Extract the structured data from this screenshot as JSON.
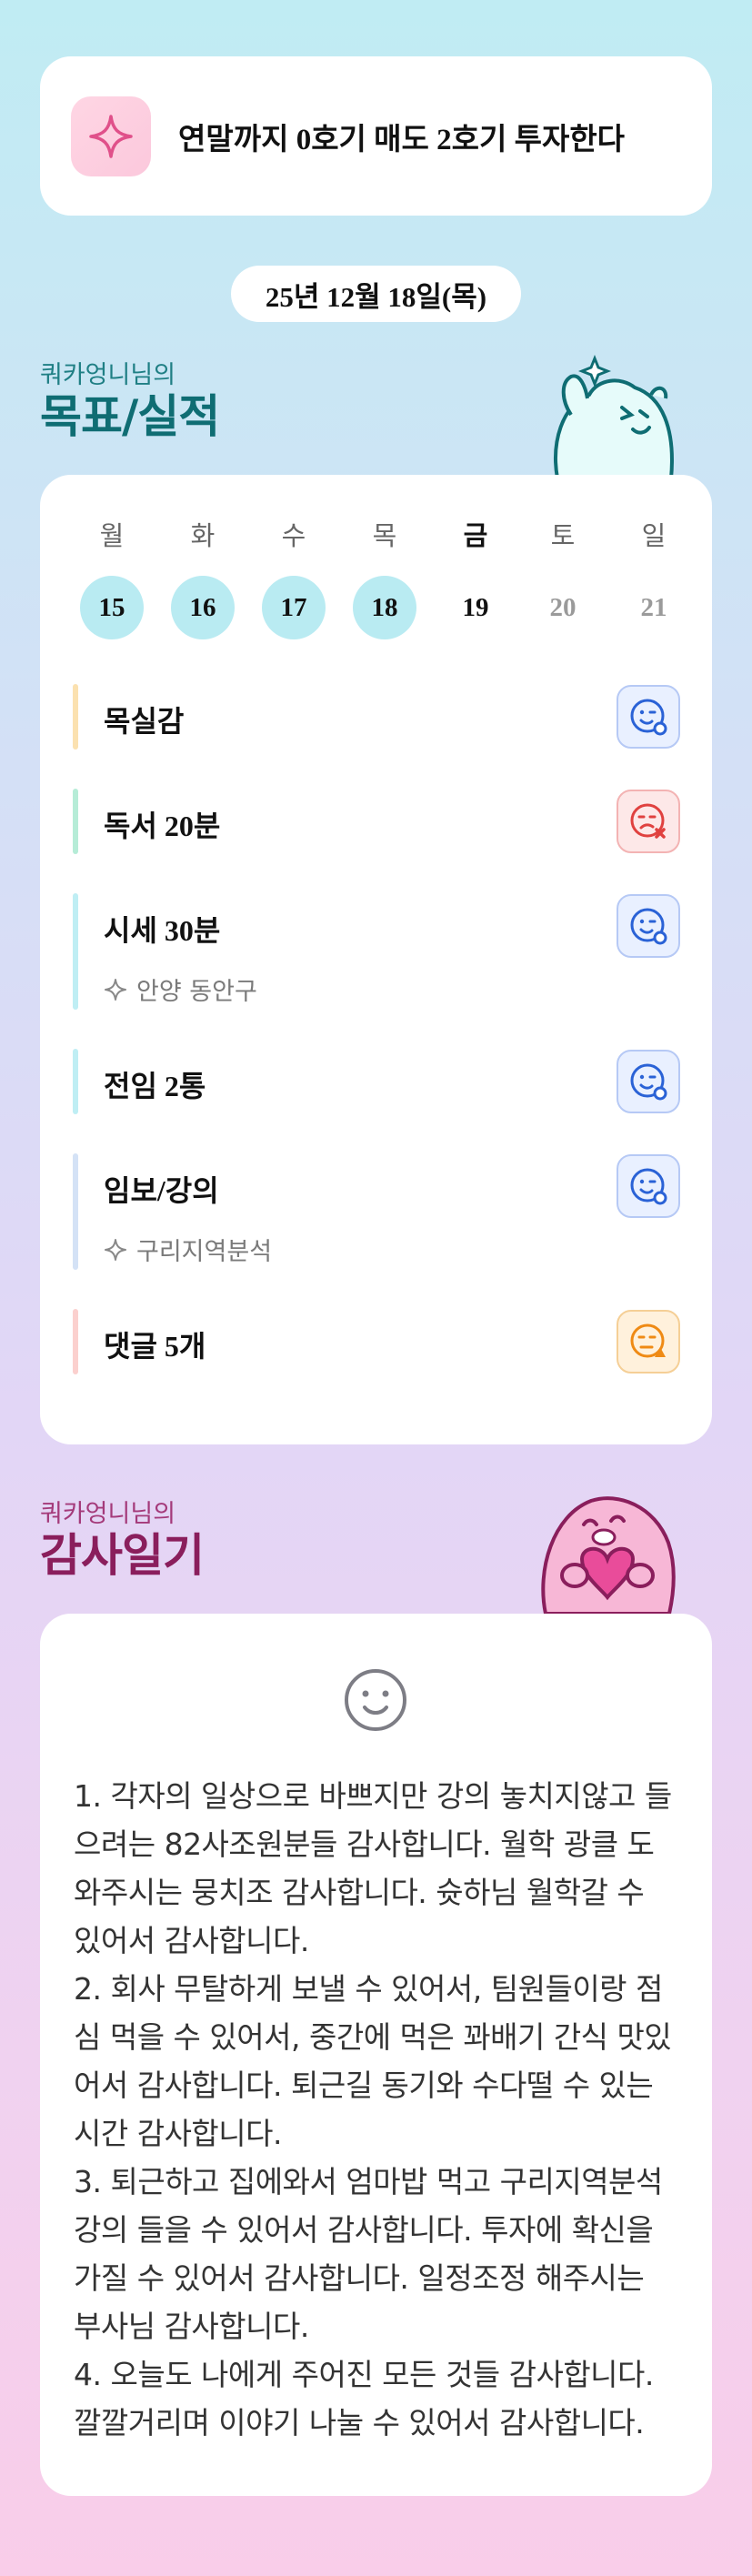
{
  "goal": {
    "text": "연말까지 0호기 매도 2호기 투자한다",
    "icon": "sparkle-icon"
  },
  "date_label": "25년 12월 18일(목)",
  "goals_section": {
    "subtitle": "쿼카엉니님의",
    "title": "목표/실적"
  },
  "calendar": {
    "weekdays": [
      "월",
      "화",
      "수",
      "목",
      "금",
      "토",
      "일"
    ],
    "days": [
      "15",
      "16",
      "17",
      "18",
      "19",
      "20",
      "21"
    ],
    "today_index": 4
  },
  "tasks": [
    {
      "label": "목실감",
      "sub": "",
      "bar_color": "#fbe1b0",
      "status": "done"
    },
    {
      "label": "독서 20분",
      "sub": "",
      "bar_color": "#b6ecd7",
      "status": "missed"
    },
    {
      "label": "시세 30분",
      "sub": "안양 동안구",
      "bar_color": "#bfeef4",
      "status": "done"
    },
    {
      "label": "전임 2통",
      "sub": "",
      "bar_color": "#bfeef4",
      "status": "done"
    },
    {
      "label": "임보/강의",
      "sub": "구리지역분석",
      "bar_color": "#d4e2f6",
      "status": "done"
    },
    {
      "label": "댓글 5개",
      "sub": "",
      "bar_color": "#fbd0ce",
      "status": "partial"
    }
  ],
  "diary_section": {
    "subtitle": "쿼카엉니님의",
    "title": "감사일기"
  },
  "diary": {
    "icon": "smile-icon",
    "lines": [
      "1. 각자의 일상으로 바쁘지만 강의 놓치지않고 들",
      "으려는 82사조원분들 감사합니다. 월학 광클 도",
      "와주시는 뭉치조 감사합니다. 슛하님 월학갈 수",
      "있어서 감사합니다.",
      "2. 회사 무탈하게 보낼 수 있어서, 팀원들이랑 점",
      "심 먹을 수 있어서, 중간에 먹은 꽈배기 간식 맛있",
      "어서 감사합니다. 퇴근길 동기와 수다떨 수 있는",
      "시간 감사합니다.",
      "3. 퇴근하고 집에와서 엄마밥 먹고 구리지역분석",
      "강의 들을 수 있어서 감사합니다. 투자에 확신을",
      "가질 수 있어서 감사합니다. 일정조정 해주시는",
      "부사님 감사합니다.",
      "4. 오늘도 나에게 주어진 모든 것들 감사합니다.",
      "깔깔거리며 이야기 나눌 수 있어서 감사합니다."
    ]
  },
  "colors": {
    "accent_teal": "#0f6d73",
    "accent_pink": "#8a1e5c",
    "done_circle": "#b9ebf2"
  }
}
